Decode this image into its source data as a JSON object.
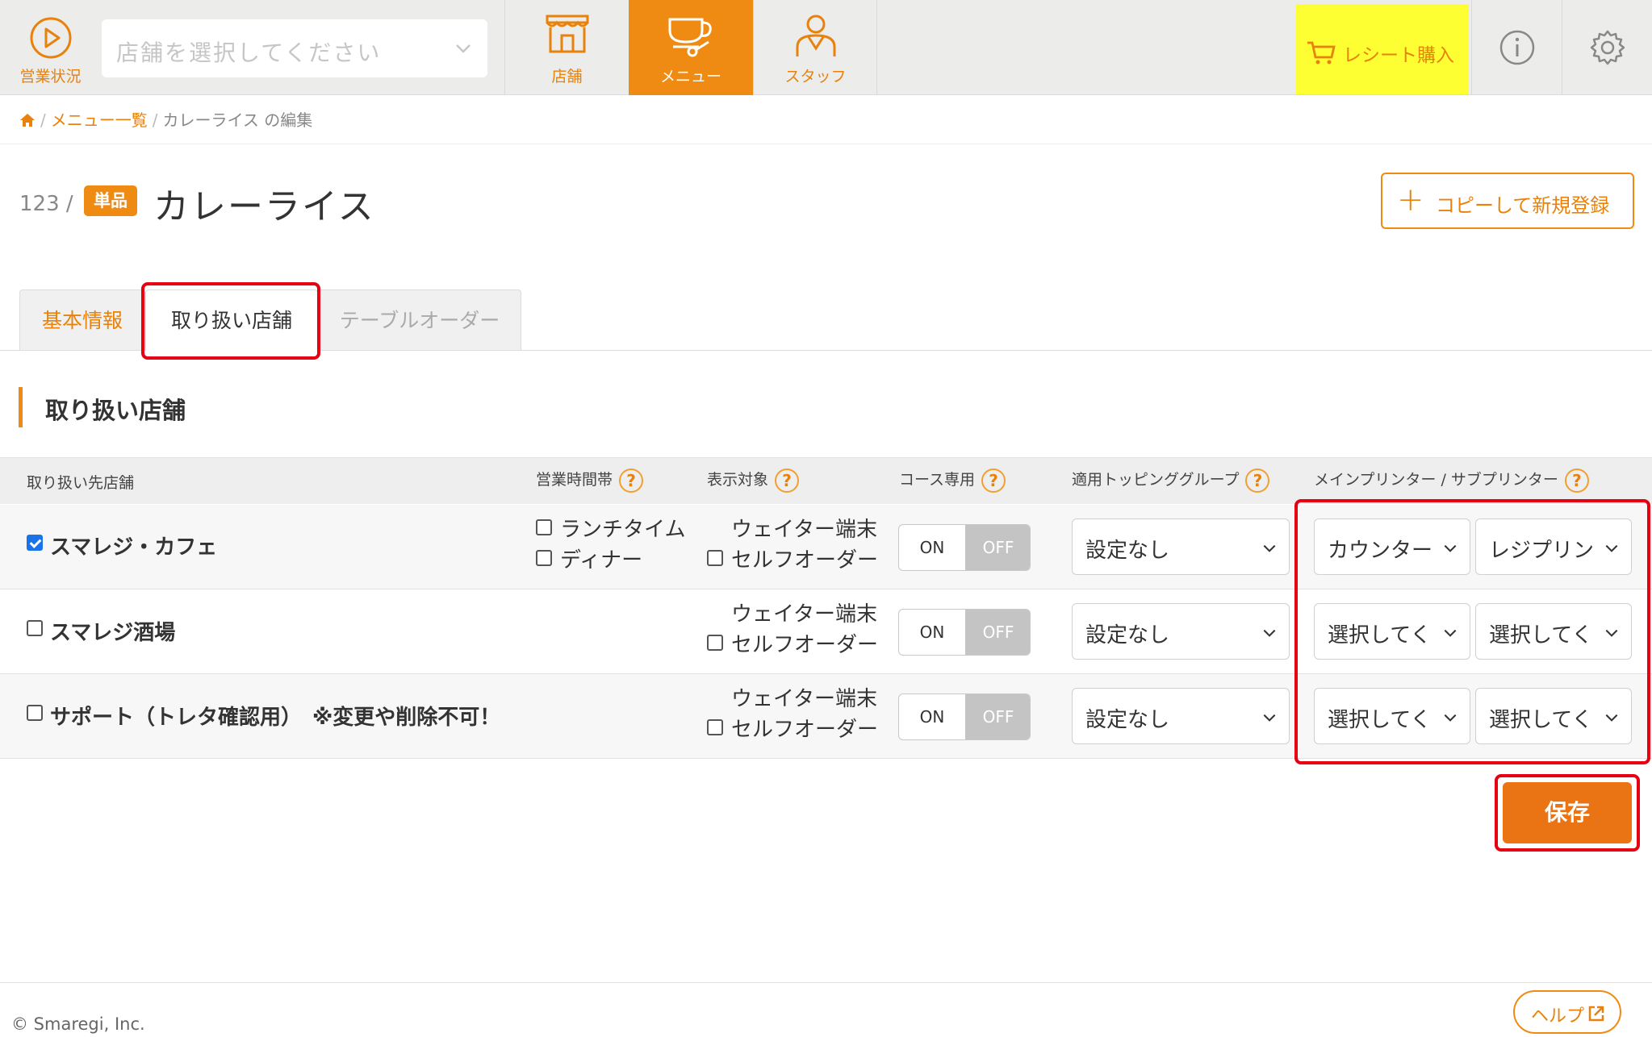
{
  "header": {
    "status_label": "営業状況",
    "store_select_placeholder": "店舗を選択してください",
    "nav": [
      {
        "label": "店舗",
        "icon": "store-icon"
      },
      {
        "label": "メニュー",
        "icon": "menu-cup-icon"
      },
      {
        "label": "スタッフ",
        "icon": "staff-icon"
      }
    ],
    "active_nav": "メニュー",
    "receipt_label": "レシート購入",
    "accent_color": "#ef8a12",
    "receipt_color": "#fdff33"
  },
  "breadcrumb": {
    "items": [
      "メニュー一覧",
      "カレーライス の編集"
    ]
  },
  "item": {
    "id": "123 /",
    "badge": "単品",
    "title": "カレーライス",
    "copy_button": "コピーして新規登録"
  },
  "tabs": [
    {
      "label": "基本情報"
    },
    {
      "label": "取り扱い店舗",
      "active": true
    },
    {
      "label": "テーブルオーダー"
    }
  ],
  "section_title": "取り扱い店舗",
  "table": {
    "headers": {
      "store": "取り扱い先店舗",
      "hours": "営業時間帯",
      "display": "表示対象",
      "course": "コース専用",
      "topping": "適用トッピンググループ",
      "printer": "メインプリンター / サブプリンター"
    },
    "help_glyph": "?",
    "rows": [
      {
        "store": "スマレジ・カフェ",
        "checked": true,
        "hours": [
          "ランチタイム",
          "ディナー"
        ],
        "display_waiter": "ウェイター端末",
        "display_self": "セルフオーダー",
        "on_label": "ON",
        "off_label": "OFF",
        "topping": "設定なし",
        "main_printer": "カウンター",
        "sub_printer": "レジプリン"
      },
      {
        "store": "スマレジ酒場",
        "checked": false,
        "display_waiter": "ウェイター端末",
        "display_self": "セルフオーダー",
        "on_label": "ON",
        "off_label": "OFF",
        "topping": "設定なし",
        "main_printer": "選択してく",
        "sub_printer": "選択してく"
      },
      {
        "store": "サポート（トレタ確認用）　※変更や削除不可！",
        "checked": false,
        "display_waiter": "ウェイター端末",
        "display_self": "セルフオーダー",
        "on_label": "ON",
        "off_label": "OFF",
        "topping": "設定なし",
        "main_printer": "選択してく",
        "sub_printer": "選択してく"
      }
    ]
  },
  "save_label": "保存",
  "footer": {
    "copyright": "© Smaregi, Inc.",
    "help_label": "ヘルプ"
  }
}
